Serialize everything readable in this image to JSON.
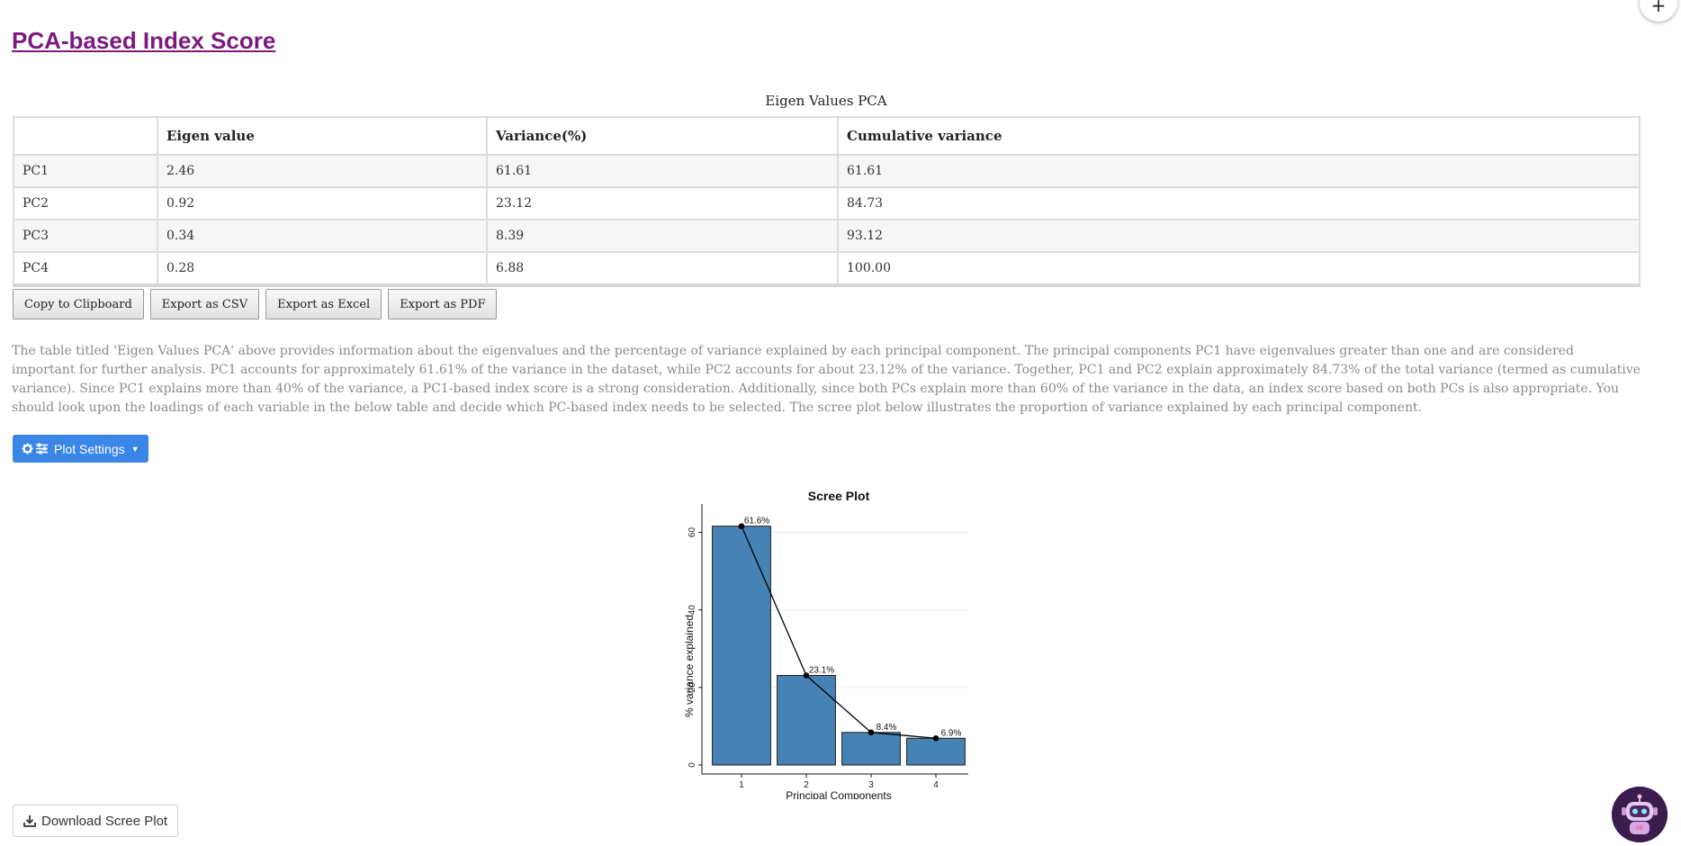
{
  "page": {
    "title": "PCA-based Index Score"
  },
  "fab": {
    "label": "+"
  },
  "table": {
    "caption": "Eigen Values PCA",
    "headers": [
      "",
      "Eigen value",
      "Variance(%)",
      "Cumulative variance"
    ],
    "rows": [
      [
        "PC1",
        "2.46",
        "61.61",
        "61.61"
      ],
      [
        "PC2",
        "0.92",
        "23.12",
        "84.73"
      ],
      [
        "PC3",
        "0.34",
        "8.39",
        "93.12"
      ],
      [
        "PC4",
        "0.28",
        "6.88",
        "100.00"
      ]
    ]
  },
  "export_buttons": {
    "copy": "Copy to Clipboard",
    "csv": "Export as CSV",
    "excel": "Export as Excel",
    "pdf": "Export as PDF"
  },
  "description": "The table titled 'Eigen Values PCA' above provides information about the eigenvalues and the percentage of variance explained by each principal component. The principal components PC1 have eigenvalues greater than one and are considered important for further analysis. PC1 accounts for approximately 61.61% of the variance in the dataset, while PC2 accounts for about 23.12% of the variance. Together, PC1 and PC2 explain approximately 84.73% of the total variance (termed as cumulative variance). Since PC1 explains more than 40% of the variance, a PC1-based index score is a strong consideration. Additionally, since both PCs explain more than 60% of the variance in the data, an index score based on both PCs is also appropriate. You should look upon the loadings of each variable in the below table and decide which PC-based index needs to be selected. The scree plot below illustrates the proportion of variance explained by each principal component.",
  "plot_settings": {
    "label": "Plot Settings",
    "icons": [
      "gear-icon",
      "sliders-icon",
      "caret-down-icon"
    ]
  },
  "download": {
    "label": "Download Scree Plot",
    "icon": "download-icon"
  },
  "colors": {
    "title": "#7b1a7e",
    "accent": "#3a86e6",
    "bar": "#4682b4"
  },
  "chart_data": {
    "type": "bar",
    "title": "Scree Plot",
    "xlabel": "Principal Components",
    "ylabel": "% variance explained",
    "categories": [
      "1",
      "2",
      "3",
      "4"
    ],
    "values": [
      61.6,
      23.1,
      8.4,
      6.9
    ],
    "data_labels": [
      "61.6%",
      "23.1%",
      "8.4%",
      "6.9%"
    ],
    "line_overlay": true,
    "ylim": [
      0,
      65
    ],
    "yticks": [
      0,
      20,
      40,
      60
    ],
    "grid": true
  }
}
